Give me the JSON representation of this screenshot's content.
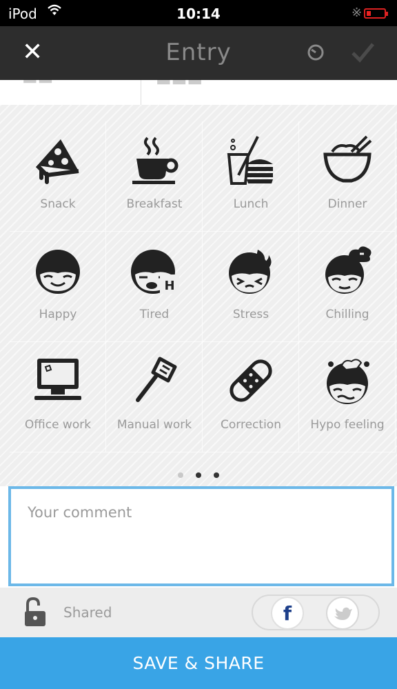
{
  "status_bar": {
    "carrier": "iPod",
    "time": "10:14"
  },
  "nav": {
    "title": "Entry",
    "close_icon": "close-icon",
    "history_icon": "clock-icon",
    "confirm_icon": "checkmark-icon"
  },
  "categories": [
    {
      "label": "Snack",
      "icon": "pizza-slice-icon"
    },
    {
      "label": "Breakfast",
      "icon": "coffee-cup-icon"
    },
    {
      "label": "Lunch",
      "icon": "burger-drink-icon"
    },
    {
      "label": "Dinner",
      "icon": "noodle-bowl-icon"
    },
    {
      "label": "Happy",
      "icon": "happy-face-icon"
    },
    {
      "label": "Tired",
      "icon": "tired-face-icon"
    },
    {
      "label": "Stress",
      "icon": "stressed-face-icon"
    },
    {
      "label": "Chilling",
      "icon": "chilling-face-icon"
    },
    {
      "label": "Office work",
      "icon": "computer-icon"
    },
    {
      "label": "Manual work",
      "icon": "spatula-icon"
    },
    {
      "label": "Correction",
      "icon": "bandage-icon"
    },
    {
      "label": "Hypo feeling",
      "icon": "hypo-face-icon"
    }
  ],
  "pagination": {
    "pages": 3,
    "current": 2
  },
  "comment": {
    "placeholder": "Your comment",
    "value": ""
  },
  "share": {
    "label": "Shared",
    "facebook_label": "f",
    "twitter_icon": "twitter-bird-icon"
  },
  "save_button": {
    "label": "SAVE & SHARE"
  },
  "colors": {
    "accent": "#39A4E6",
    "nav_bg": "#2D2D2D",
    "facebook": "#1D3F8A"
  }
}
